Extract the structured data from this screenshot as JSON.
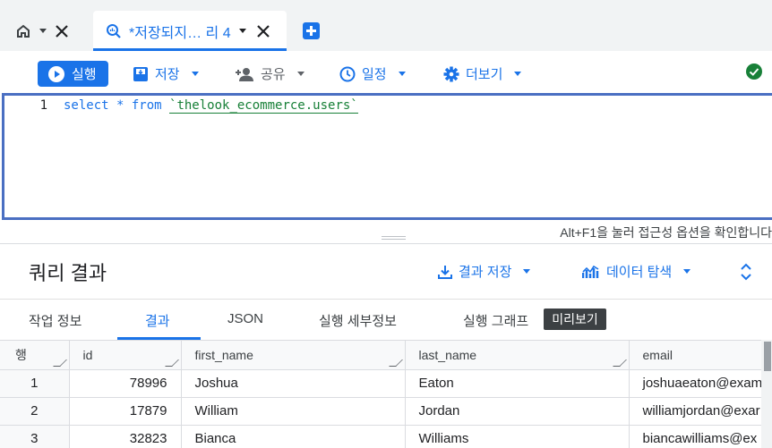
{
  "tabs": {
    "query_tab_label": "*저장되지… 리 4"
  },
  "toolbar": {
    "run_label": "실행",
    "save_label": "저장",
    "share_label": "공유",
    "schedule_label": "일정",
    "more_label": "더보기"
  },
  "editor": {
    "line_number": "1",
    "code_prefix": "select * from ",
    "table_ref": "`thelook_ecommerce.users`",
    "a11y_hint": "Alt+F1을 눌러 접근성 옵션을 확인합니다"
  },
  "results": {
    "title": "쿼리 결과",
    "save_results_label": "결과 저장",
    "explore_data_label": "데이터 탐색",
    "tabs": [
      "작업 정보",
      "결과",
      "JSON",
      "실행 세부정보",
      "실행 그래프"
    ],
    "preview_badge": "미리보기",
    "columns": [
      "행",
      "id",
      "first_name",
      "last_name",
      "email"
    ],
    "rows": [
      [
        "1",
        "78996",
        "Joshua",
        "Eaton",
        "joshuaeaton@exam"
      ],
      [
        "2",
        "17879",
        "William",
        "Jordan",
        "williamjordan@exar"
      ],
      [
        "3",
        "32823",
        "Bianca",
        "Williams",
        "biancawilliams@ex"
      ]
    ]
  },
  "colors": {
    "accent": "#1a73e8",
    "success": "#188038",
    "editor_border": "#4a6fc2"
  }
}
